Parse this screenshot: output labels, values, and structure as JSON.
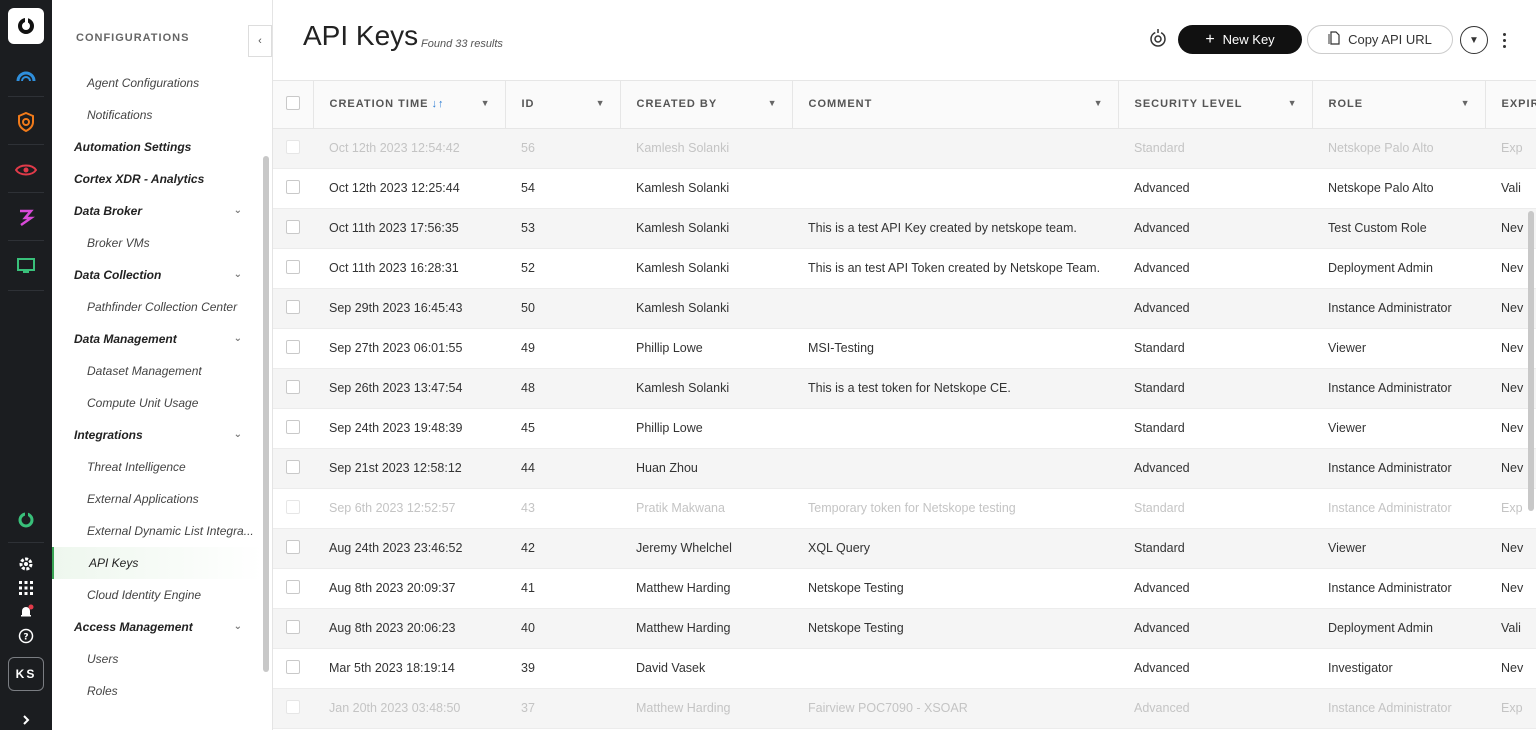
{
  "rail": {
    "avatar": "KS"
  },
  "sidebar": {
    "heading": "CONFIGURATIONS",
    "collapse": "‹",
    "items": [
      {
        "label": "Agent Configurations",
        "type": "sub"
      },
      {
        "label": "Notifications",
        "type": "sub"
      },
      {
        "label": "Automation Settings",
        "type": "grp"
      },
      {
        "label": "Cortex XDR - Analytics",
        "type": "grp"
      },
      {
        "label": "Data Broker",
        "type": "grp",
        "chevron": true
      },
      {
        "label": "Broker VMs",
        "type": "sub"
      },
      {
        "label": "Data Collection",
        "type": "grp",
        "chevron": true
      },
      {
        "label": "Pathfinder Collection Center",
        "type": "sub"
      },
      {
        "label": "Data Management",
        "type": "grp",
        "chevron": true
      },
      {
        "label": "Dataset Management",
        "type": "sub"
      },
      {
        "label": "Compute Unit Usage",
        "type": "sub"
      },
      {
        "label": "Integrations",
        "type": "grp",
        "chevron": true
      },
      {
        "label": "Threat Intelligence",
        "type": "sub"
      },
      {
        "label": "External Applications",
        "type": "sub"
      },
      {
        "label": "External Dynamic List Integra...",
        "type": "sub"
      },
      {
        "label": "API Keys",
        "type": "sub",
        "active": true
      },
      {
        "label": "Cloud Identity Engine",
        "type": "sub"
      },
      {
        "label": "Access Management",
        "type": "grp",
        "chevron": true
      },
      {
        "label": "Users",
        "type": "sub"
      },
      {
        "label": "Roles",
        "type": "sub"
      }
    ]
  },
  "header": {
    "title": "API Keys",
    "found": "Found 33 results",
    "new_key": "New Key",
    "copy_url": "Copy API URL"
  },
  "table": {
    "columns": [
      "CREATION TIME",
      "ID",
      "CREATED BY",
      "COMMENT",
      "SECURITY LEVEL",
      "ROLE",
      "EXPIR"
    ],
    "rows": [
      {
        "time": "Oct 12th 2023 12:54:42",
        "id": "56",
        "by": "Kamlesh Solanki",
        "comment": "",
        "level": "Standard",
        "role": "Netskope Palo Alto",
        "exp": "Exp",
        "dim": true
      },
      {
        "time": "Oct 12th 2023 12:25:44",
        "id": "54",
        "by": "Kamlesh Solanki",
        "comment": "",
        "level": "Advanced",
        "role": "Netskope Palo Alto",
        "exp": "Vali"
      },
      {
        "time": "Oct 11th 2023 17:56:35",
        "id": "53",
        "by": "Kamlesh Solanki",
        "comment": "This is a test API Key created by netskope team.",
        "level": "Advanced",
        "role": "Test Custom Role",
        "exp": "Nev"
      },
      {
        "time": "Oct 11th 2023 16:28:31",
        "id": "52",
        "by": "Kamlesh Solanki",
        "comment": "This is an test API Token created by Netskope Team.",
        "level": "Advanced",
        "role": "Deployment Admin",
        "exp": "Nev"
      },
      {
        "time": "Sep 29th 2023 16:45:43",
        "id": "50",
        "by": "Kamlesh Solanki",
        "comment": "",
        "level": "Advanced",
        "role": "Instance Administrator",
        "exp": "Nev"
      },
      {
        "time": "Sep 27th 2023 06:01:55",
        "id": "49",
        "by": "Phillip Lowe",
        "comment": "MSI-Testing",
        "level": "Standard",
        "role": "Viewer",
        "exp": "Nev"
      },
      {
        "time": "Sep 26th 2023 13:47:54",
        "id": "48",
        "by": "Kamlesh Solanki",
        "comment": "This is a test token for Netskope CE.",
        "level": "Standard",
        "role": "Instance Administrator",
        "exp": "Nev"
      },
      {
        "time": "Sep 24th 2023 19:48:39",
        "id": "45",
        "by": "Phillip Lowe",
        "comment": "",
        "level": "Standard",
        "role": "Viewer",
        "exp": "Nev"
      },
      {
        "time": "Sep 21st 2023 12:58:12",
        "id": "44",
        "by": "Huan Zhou",
        "comment": "",
        "level": "Advanced",
        "role": "Instance Administrator",
        "exp": "Nev"
      },
      {
        "time": "Sep 6th 2023 12:52:57",
        "id": "43",
        "by": "Pratik Makwana",
        "comment": "Temporary token for Netskope testing",
        "level": "Standard",
        "role": "Instance Administrator",
        "exp": "Exp",
        "dim": true
      },
      {
        "time": "Aug 24th 2023 23:46:52",
        "id": "42",
        "by": "Jeremy Whelchel",
        "comment": "XQL Query",
        "level": "Standard",
        "role": "Viewer",
        "exp": "Nev"
      },
      {
        "time": "Aug 8th 2023 20:09:37",
        "id": "41",
        "by": "Matthew Harding",
        "comment": "Netskope Testing",
        "level": "Advanced",
        "role": "Instance Administrator",
        "exp": "Nev"
      },
      {
        "time": "Aug 8th 2023 20:06:23",
        "id": "40",
        "by": "Matthew Harding",
        "comment": "Netskope Testing",
        "level": "Advanced",
        "role": "Deployment Admin",
        "exp": "Vali"
      },
      {
        "time": "Mar 5th 2023 18:19:14",
        "id": "39",
        "by": "David Vasek",
        "comment": "",
        "level": "Advanced",
        "role": "Investigator",
        "exp": "Nev"
      },
      {
        "time": "Jan 20th 2023 03:48:50",
        "id": "37",
        "by": "Matthew Harding",
        "comment": "Fairview POC7090 - XSOAR",
        "level": "Advanced",
        "role": "Instance Administrator",
        "exp": "Exp",
        "dim": true
      }
    ]
  }
}
